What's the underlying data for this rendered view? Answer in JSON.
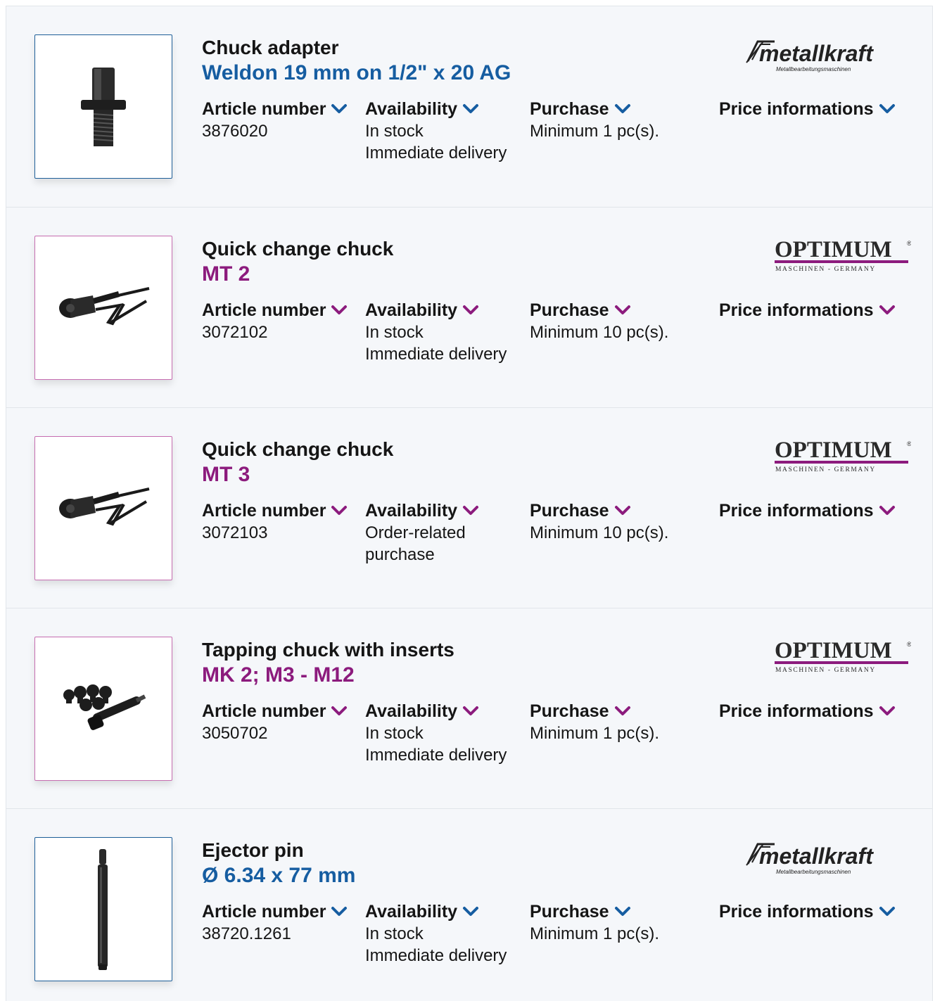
{
  "labels": {
    "article_number": "Article number",
    "availability": "Availability",
    "purchase": "Purchase",
    "price_informations": "Price informations"
  },
  "brands": {
    "metallkraft": {
      "name": "metallkraft",
      "tagline": "Metallbearbeitungsmaschinen",
      "accent": "#165da1"
    },
    "optimum": {
      "name": "OPTIMUM",
      "tagline": "MASCHINEN - GERMANY",
      "accent": "#8c1b7d"
    }
  },
  "products": [
    {
      "title": "Chuck adapter",
      "subtitle": "Weldon 19 mm on 1/2\" x 20 AG",
      "article_number": "3876020",
      "availability_1": "In stock",
      "availability_2": "Immediate delivery",
      "purchase": "Minimum 1 pc(s).",
      "brand": "metallkraft",
      "image_icon": "chuck-adapter-image"
    },
    {
      "title": "Quick change chuck",
      "subtitle": "MT 2",
      "article_number": "3072102",
      "availability_1": "In stock",
      "availability_2": "Immediate delivery",
      "purchase": "Minimum 10 pc(s).",
      "brand": "optimum",
      "image_icon": "quick-change-chuck-image"
    },
    {
      "title": "Quick change chuck",
      "subtitle": "MT 3",
      "article_number": "3072103",
      "availability_1": "Order-related",
      "availability_2": "purchase",
      "purchase": "Minimum 10 pc(s).",
      "brand": "optimum",
      "image_icon": "quick-change-chuck-image"
    },
    {
      "title": "Tapping chuck with inserts",
      "subtitle": "MK 2; M3 - M12",
      "article_number": "3050702",
      "availability_1": "In stock",
      "availability_2": "Immediate delivery",
      "purchase": "Minimum 1 pc(s).",
      "brand": "optimum",
      "image_icon": "tapping-chuck-image"
    },
    {
      "title": "Ejector pin",
      "subtitle": "Ø 6.34 x 77 mm",
      "article_number": "38720.1261",
      "availability_1": "In stock",
      "availability_2": "Immediate delivery",
      "purchase": "Minimum 1 pc(s).",
      "brand": "metallkraft",
      "image_icon": "ejector-pin-image"
    }
  ]
}
